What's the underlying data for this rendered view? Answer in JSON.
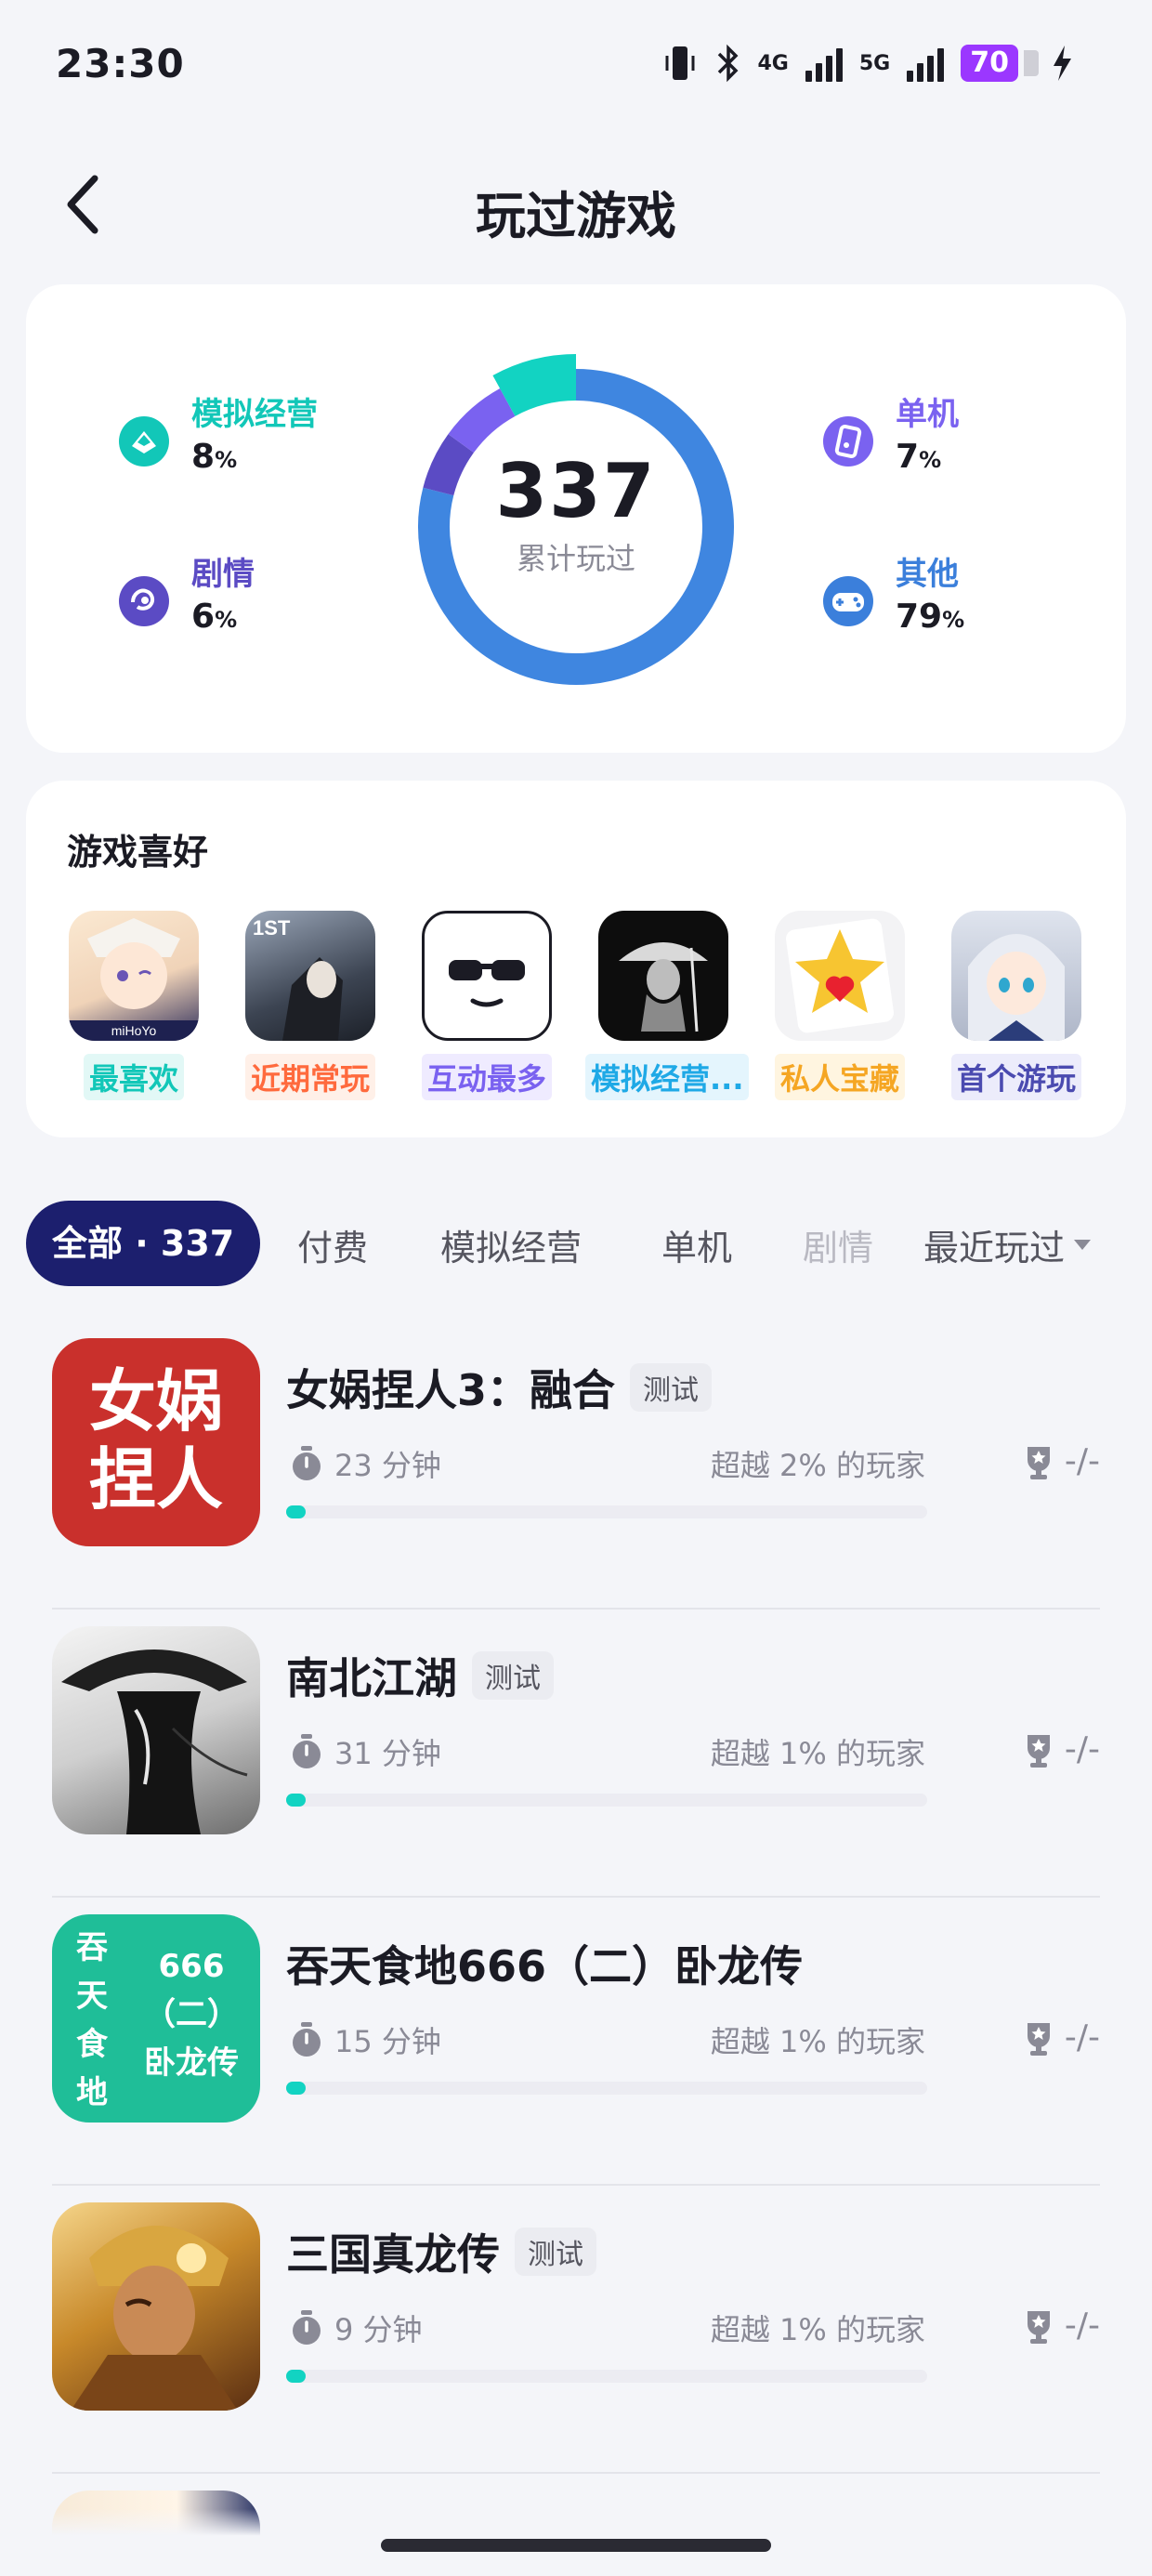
{
  "status_bar": {
    "time": "23:30",
    "net1": "4G",
    "net2": "5G",
    "battery": "70"
  },
  "header": {
    "title": "玩过游戏"
  },
  "summary": {
    "total": "337",
    "total_label": "累计玩过",
    "stats": [
      {
        "label": "模拟经营",
        "value": "8",
        "unit": "%",
        "color": "#12c7b8",
        "icon": "building-icon"
      },
      {
        "label": "剧情",
        "value": "6",
        "unit": "%",
        "color": "#5b4bc4",
        "icon": "story-icon"
      },
      {
        "label": "单机",
        "value": "7",
        "unit": "%",
        "color": "#7a62f0",
        "icon": "phone-game-icon"
      },
      {
        "label": "其他",
        "value": "79",
        "unit": "%",
        "color": "#3b7fdb",
        "icon": "gamepad-icon"
      }
    ],
    "chart_data": {
      "type": "pie",
      "categories": [
        "其他",
        "剧情",
        "单机",
        "模拟经营"
      ],
      "values": [
        79,
        6,
        7,
        8
      ],
      "colors": [
        "#3f86e0",
        "#5b4bc4",
        "#7a62f0",
        "#12d3c2"
      ]
    }
  },
  "preferences": {
    "title": "游戏喜好",
    "items": [
      {
        "tag": "最喜欢",
        "tag_color": "#12c7b8",
        "icon": "anime-girl-game-icon",
        "logo": "miHoYo"
      },
      {
        "tag": "近期常玩",
        "tag_color": "#ff6a3d",
        "icon": "dark-hero-game-icon",
        "logo": "1ST"
      },
      {
        "tag": "互动最多",
        "tag_color": "#7a62f0",
        "icon": "sunglasses-face-icon"
      },
      {
        "tag": "模拟经营...",
        "tag_color": "#1fa9e6",
        "icon": "samurai-game-icon"
      },
      {
        "tag": "私人宝藏",
        "tag_color": "#f5a623",
        "icon": "star-heart-icon"
      },
      {
        "tag": "首个游玩",
        "tag_color": "#4b4bb0",
        "icon": "anime-maid-game-icon"
      }
    ]
  },
  "filters": {
    "all_label": "全部 · 337",
    "tabs": [
      "付费",
      "模拟经营",
      "单机",
      "剧情"
    ],
    "sort_label": "最近玩过"
  },
  "games": [
    {
      "name": "女娲捏人3：融合",
      "badge": "测试",
      "time": "23 分钟",
      "beat": "超越 2% 的玩家",
      "trophy": "-/-",
      "progress": 0.03,
      "icon_text": [
        "女娲",
        "捏人"
      ],
      "icon_bg": "#c9302c"
    },
    {
      "name": "南北江湖",
      "badge": "测试",
      "time": "31 分钟",
      "beat": "超越 1% 的玩家",
      "trophy": "-/-",
      "progress": 0.03,
      "icon_bg": "#d8d8d8"
    },
    {
      "name": "吞天食地666（二）卧龙传",
      "badge": "",
      "time": "15 分钟",
      "beat": "超越 1% 的玩家",
      "trophy": "-/-",
      "progress": 0.03,
      "icon_text_left": [
        "吞",
        "天",
        "食",
        "地"
      ],
      "icon_text_right": [
        "666",
        "（二）",
        "卧龙传"
      ],
      "icon_bg": "#1fbe98"
    },
    {
      "name": "三国真龙传",
      "badge": "测试",
      "time": "9 分钟",
      "beat": "超越 1% 的玩家",
      "trophy": "-/-",
      "progress": 0.03,
      "icon_bg": "#c8892a"
    }
  ]
}
